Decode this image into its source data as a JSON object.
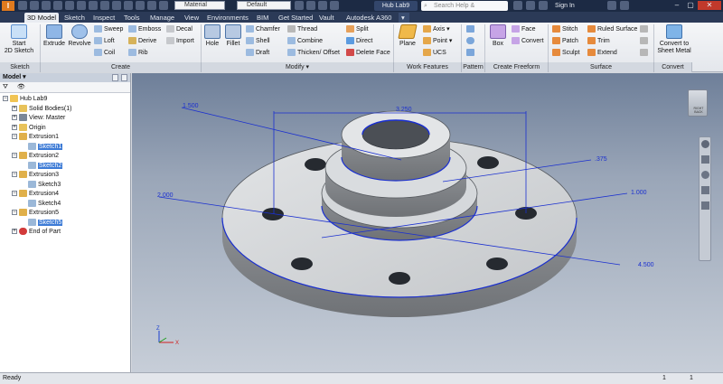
{
  "app": {
    "logo": "I"
  },
  "titlebar": {
    "material": "Material",
    "appearance": "Default",
    "document": "Hub Lab9",
    "search_placeholder": "Search Help & Commands...",
    "sign_in": "Sign In"
  },
  "tabs": [
    "3D Model",
    "Sketch",
    "Inspect",
    "Tools",
    "Manage",
    "View",
    "Environments",
    "BIM",
    "Get Started",
    "Vault",
    "Autodesk A360"
  ],
  "ribbon": {
    "sketch": {
      "start": "Start",
      "start2": "2D Sketch",
      "panel": "Sketch"
    },
    "create": {
      "extrude": "Extrude",
      "revolve": "Revolve",
      "sweep": "Sweep",
      "loft": "Loft",
      "coil": "Coil",
      "emboss": "Emboss",
      "derive": "Derive",
      "rib": "Rib",
      "decal": "Decal",
      "import": "Import",
      "panel": "Create"
    },
    "modify": {
      "hole": "Hole",
      "fillet": "Fillet",
      "chamfer": "Chamfer",
      "shell": "Shell",
      "draft": "Draft",
      "thread": "Thread",
      "combine": "Combine",
      "thicken": "Thicken/ Offset",
      "split": "Split",
      "direct": "Direct",
      "deleteface": "Delete Face",
      "panel": "Modify ▾"
    },
    "workfeatures": {
      "plane": "Plane",
      "axis": "Axis ▾",
      "point": "Point ▾",
      "ucs": "UCS",
      "panel": "Work Features"
    },
    "pattern": {
      "panel": "Pattern"
    },
    "freeform": {
      "box": "Box",
      "face": "Face",
      "convert": "Convert",
      "panel": "Create Freeform"
    },
    "surface": {
      "stitch": "Stitch",
      "patch": "Patch",
      "sculpt": "Sculpt",
      "ruled": "Ruled Surface",
      "trim": "Trim",
      "extend": "Extend",
      "panel": "Surface"
    },
    "convert": {
      "label1": "Convert to",
      "label2": "Sheet Metal",
      "panel": "Convert"
    }
  },
  "browser": {
    "title": "Model ▾",
    "nodes": [
      {
        "label": "Hub Lab9",
        "indent": 0
      },
      {
        "label": "Solid Bodies(1)",
        "indent": 1
      },
      {
        "label": "View: Master",
        "indent": 1
      },
      {
        "label": "Origin",
        "indent": 1
      },
      {
        "label": "Extrusion1",
        "indent": 1
      },
      {
        "label": "Sketch1",
        "indent": 2,
        "selected": true
      },
      {
        "label": "Extrusion2",
        "indent": 1
      },
      {
        "label": "Sketch2",
        "indent": 2,
        "selected": true
      },
      {
        "label": "Extrusion3",
        "indent": 1
      },
      {
        "label": "Sketch3",
        "indent": 2
      },
      {
        "label": "Extrusion4",
        "indent": 1
      },
      {
        "label": "Sketch4",
        "indent": 2
      },
      {
        "label": "Extrusion5",
        "indent": 1
      },
      {
        "label": "Sketch5",
        "indent": 2,
        "selected": true
      },
      {
        "label": "End of Part",
        "indent": 1
      }
    ]
  },
  "viewport": {
    "dims": {
      "d1": "1.500",
      "d2": "3.250",
      "d3": ".375",
      "d4": "2.000",
      "d5": "1.000",
      "d6": "4.500"
    },
    "viewcube": "RIGHT BACK",
    "axis_x": "X",
    "axis_z": "Z"
  },
  "status": {
    "text": "Ready",
    "n1": "1",
    "n2": "1"
  },
  "colors": {
    "accent": "#3d7bd6",
    "dimension": "#1a2fd0",
    "titlebar": "#1c2a44"
  }
}
